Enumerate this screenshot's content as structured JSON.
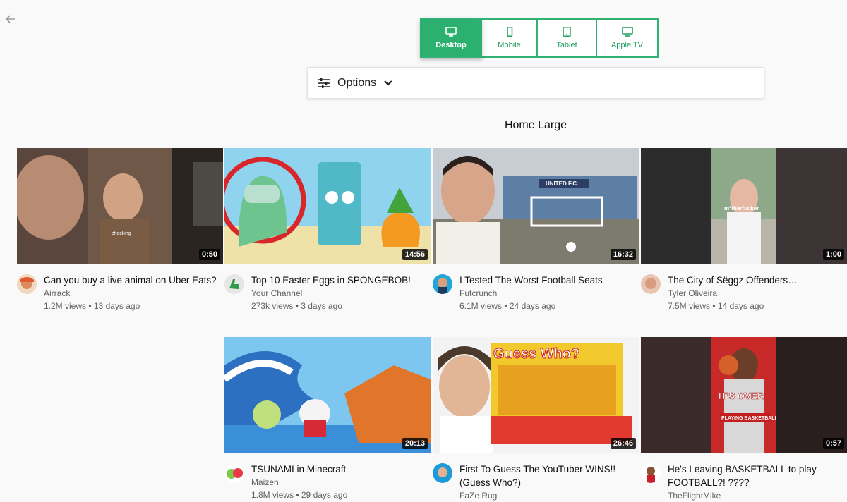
{
  "devices": [
    {
      "label": "Desktop",
      "icon": "desktop-icon",
      "active": true
    },
    {
      "label": "Mobile",
      "icon": "mobile-icon",
      "active": false
    },
    {
      "label": "Tablet",
      "icon": "tablet-icon",
      "active": false
    },
    {
      "label": "Apple TV",
      "icon": "tv-icon",
      "active": false
    }
  ],
  "options": {
    "label": "Options"
  },
  "section": {
    "title": "Home Large"
  },
  "colors": {
    "accent": "#2bb06f",
    "background": "#f9f9f9"
  },
  "videos": [
    {
      "title": "Can you buy a live animal on Uber Eats?",
      "channel": "Airrack",
      "stats": "1.2M views • 13 days ago",
      "duration": "0:50",
      "overlay": "checking"
    },
    {
      "title": "Top 10 Easter Eggs in SPONGEBOB!",
      "channel": "Your Channel",
      "stats": "273k views • 3 days ago",
      "duration": "14:56"
    },
    {
      "title": "I Tested The Worst Football Seats",
      "channel": "Futcrunch",
      "stats": "6.1M views • 24 days ago",
      "duration": "16:32",
      "overlay": "UNITED F.C."
    },
    {
      "title": "The City of Sëggz Offenders…",
      "channel": "Tyler Oliveira",
      "stats": "7.5M views • 14 days ago",
      "duration": "1:00",
      "overlay": "m*therfucker"
    },
    {
      "title": "TSUNAMI in Minecraft",
      "channel": "Maizen",
      "stats": "1.8M views • 29 days ago",
      "duration": "20:13"
    },
    {
      "title": "First To Guess The YouTuber WINS!! (Guess Who?)",
      "channel": "FaZe Rug",
      "stats": "",
      "duration": "26:46",
      "overlay": "Guess Who?"
    },
    {
      "title": "He's Leaving BASKETBALL to play FOOTBALL?! ????",
      "channel": "TheFlightMike",
      "stats": "",
      "duration": "0:57",
      "overlay": "IT'S OVER",
      "overlay2": "PLAYING BASKETBALL"
    }
  ]
}
